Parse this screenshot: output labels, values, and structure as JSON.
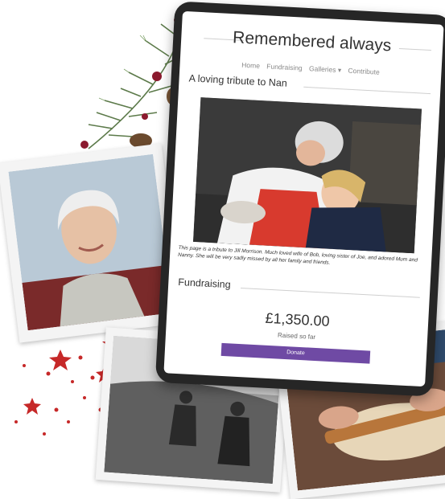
{
  "site": {
    "title": "Remembered always",
    "nav": [
      {
        "label": "Home"
      },
      {
        "label": "Fundraising"
      },
      {
        "label": "Galleries ▾"
      },
      {
        "label": "Contribute"
      }
    ]
  },
  "tribute": {
    "heading": "A loving tribute to Nan",
    "caption": "This page is a tribute to Jill Morrison. Much loved wife of Bob, loving sister of Joe, and adored Mum and Nanny. She will be very sadly missed by all her family and friends."
  },
  "fundraising": {
    "heading": "Fundraising",
    "amount": "£1,350.00",
    "raised_label": "Raised so far",
    "donate_label": "Donate"
  },
  "colors": {
    "accent": "#6f4aa4",
    "berry": "#8b1a2e",
    "star": "#c62828"
  }
}
